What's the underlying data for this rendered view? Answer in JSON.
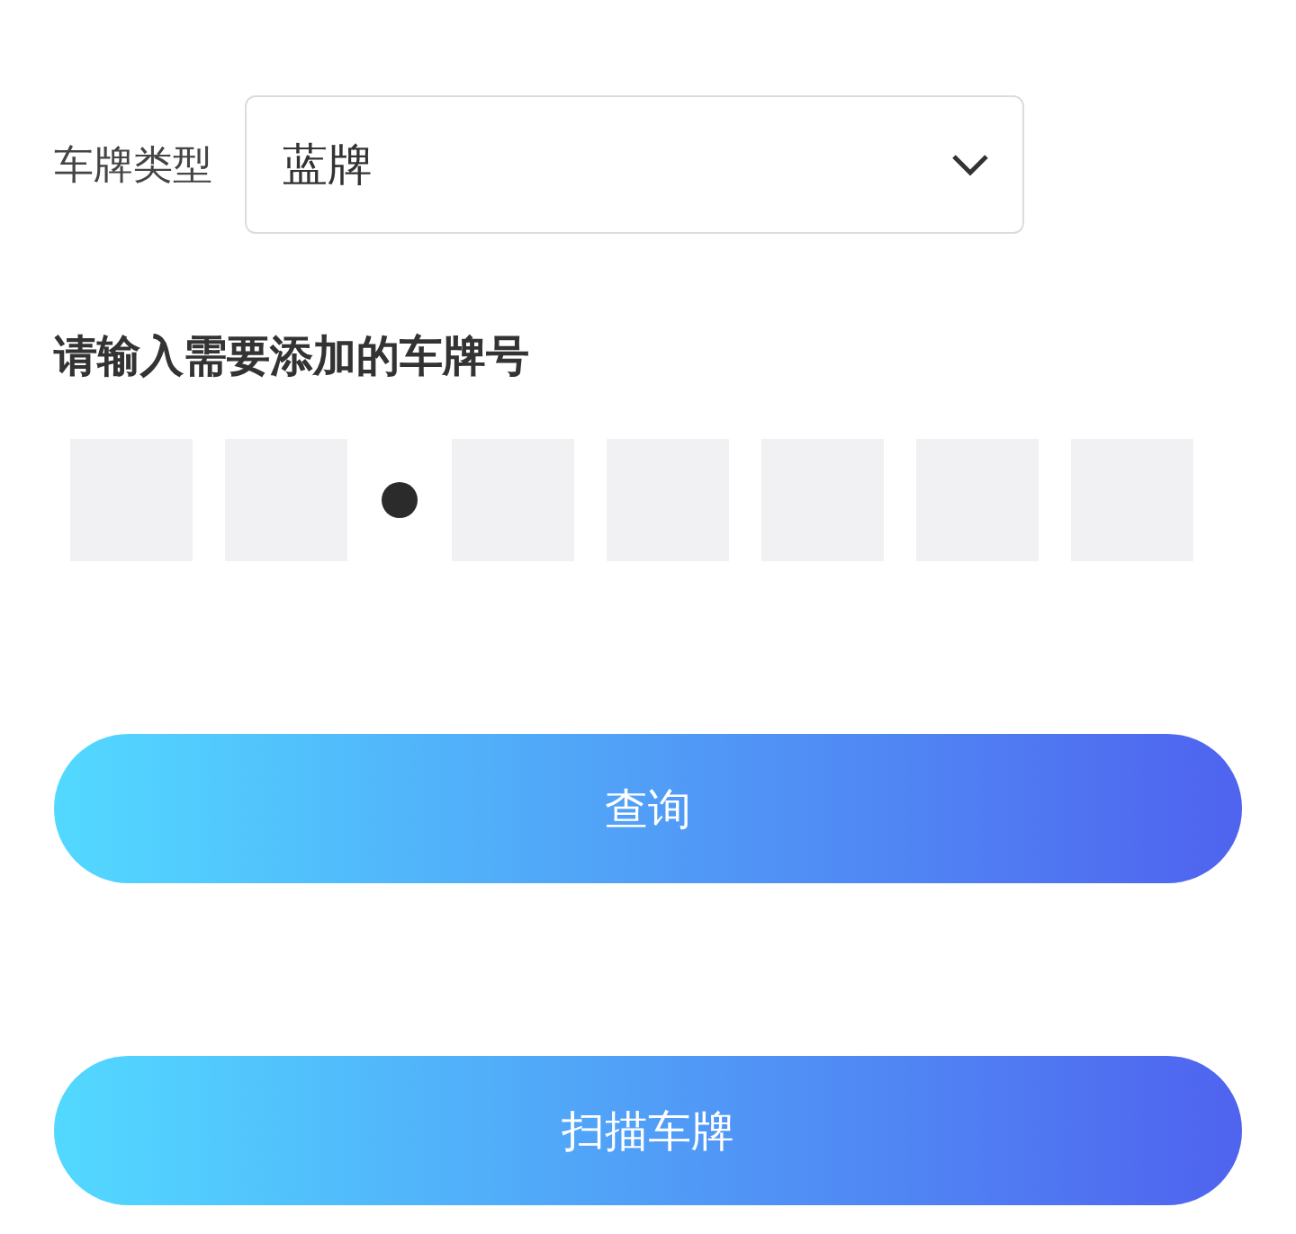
{
  "plate_type": {
    "label": "车牌类型",
    "value": "蓝牌"
  },
  "heading": "请输入需要添加的车牌号",
  "plate_slots": [
    {
      "kind": "box"
    },
    {
      "kind": "box"
    },
    {
      "kind": "separator"
    },
    {
      "kind": "box"
    },
    {
      "kind": "box"
    },
    {
      "kind": "box"
    },
    {
      "kind": "box"
    },
    {
      "kind": "box"
    }
  ],
  "buttons": [
    "查询",
    "扫描车牌"
  ]
}
